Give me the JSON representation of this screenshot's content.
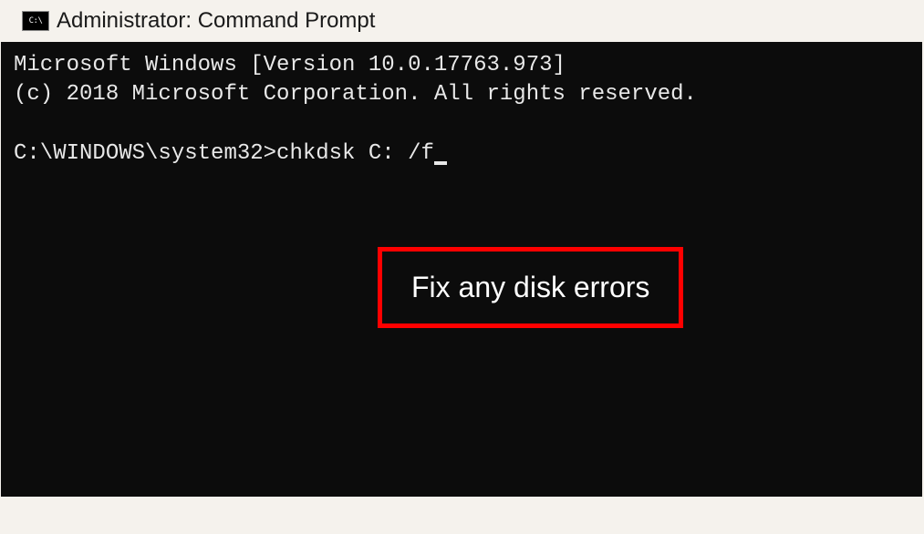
{
  "titlebar": {
    "icon_label": "C:\\",
    "title": "Administrator: Command Prompt"
  },
  "terminal": {
    "line1": "Microsoft Windows [Version 10.0.17763.973]",
    "line2": "(c) 2018 Microsoft Corporation. All rights reserved.",
    "prompt": "C:\\WINDOWS\\system32>",
    "command": "chkdsk C: /f"
  },
  "callout": {
    "text": "Fix any disk errors"
  }
}
